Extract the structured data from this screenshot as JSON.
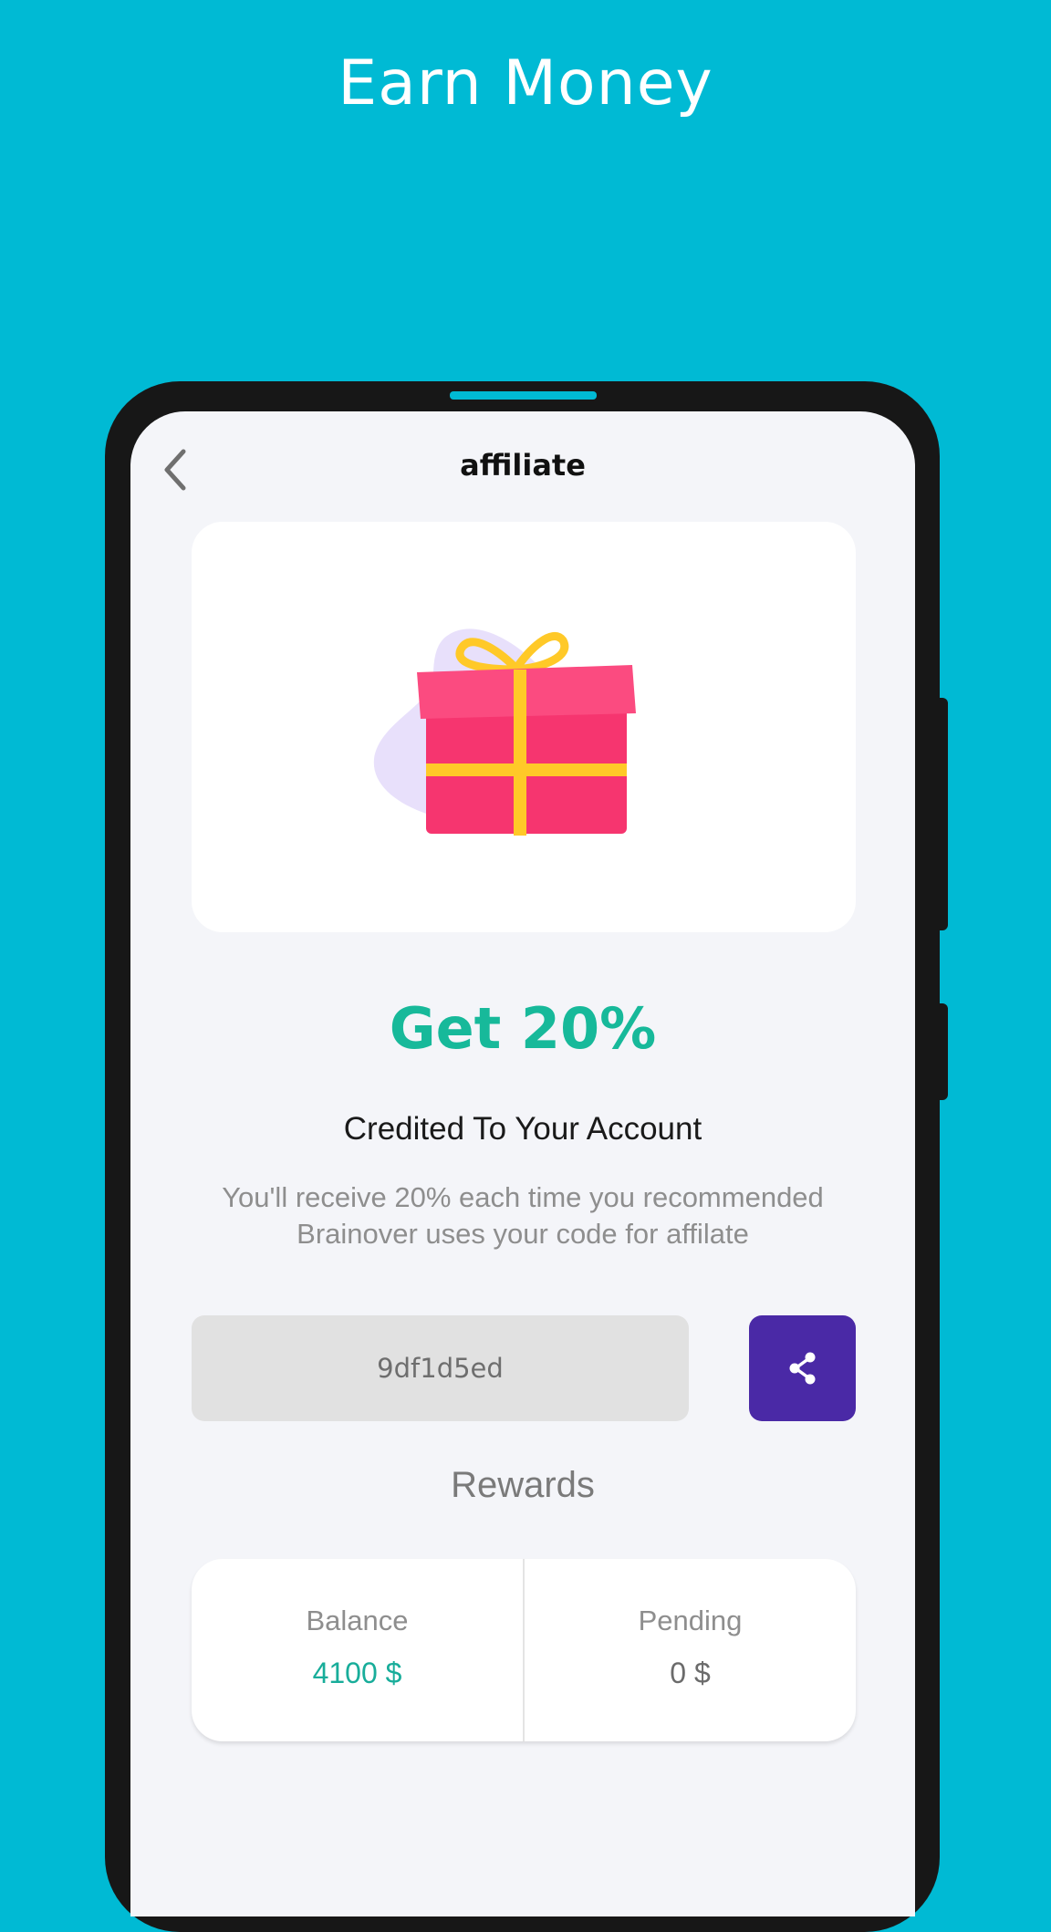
{
  "promo": {
    "title": "Earn Money"
  },
  "header": {
    "back_icon": "chevron-left-icon",
    "title": "affiliate"
  },
  "offer": {
    "illustration": "gift-box-icon",
    "headline": "Get 20%",
    "subheadline": "Credited To Your Account",
    "description": "You'll receive 20% each time you recommended Brainover uses your code for affilate"
  },
  "referral": {
    "code": "9df1d5ed",
    "share_icon": "share-icon"
  },
  "rewards": {
    "title": "Rewards",
    "balance_label": "Balance",
    "balance_value": "4100 $",
    "pending_label": "Pending",
    "pending_value": "0 $"
  },
  "colors": {
    "background": "#00bad4",
    "accent_green": "#17b99a",
    "share_button": "#4a29a6",
    "gift_pink": "#f6356f",
    "gift_ribbon": "#ffc928",
    "blob_lavender": "#e8e0fb"
  }
}
